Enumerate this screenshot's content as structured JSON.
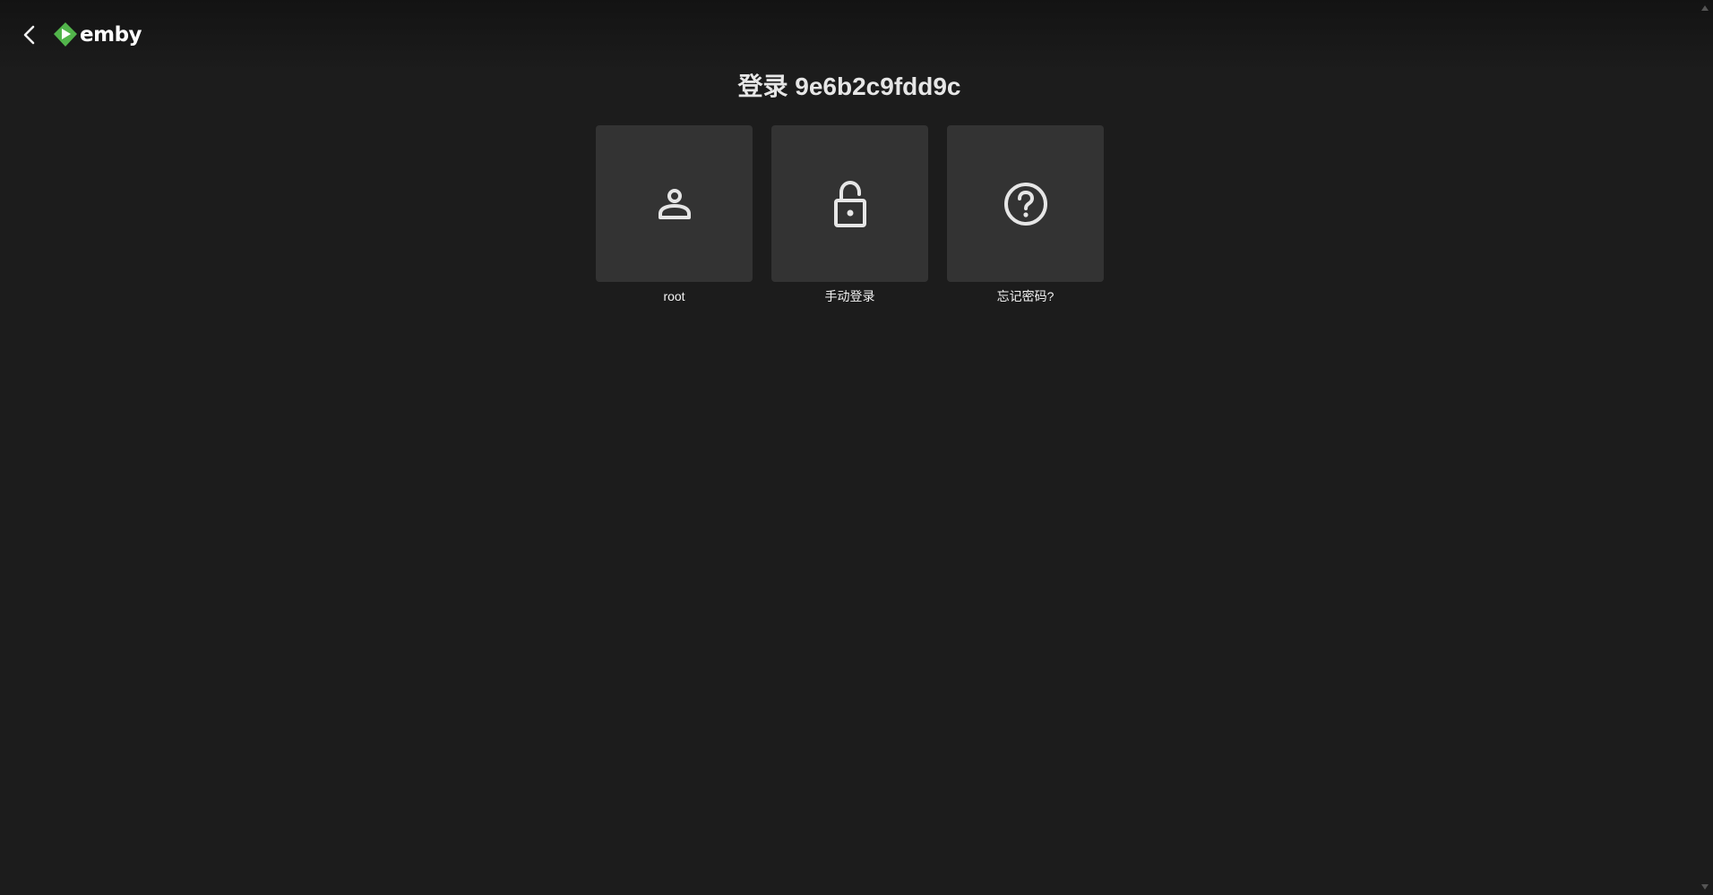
{
  "header": {
    "back_icon": "chevron-left-icon",
    "logo": {
      "icon": "emby-play-diamond-icon",
      "text": "emby",
      "brand_color": "#52b54b"
    }
  },
  "title": "登录 9e6b2c9fdd9c",
  "cards": [
    {
      "label": "root",
      "icon": "user-icon"
    },
    {
      "label": "手动登录",
      "icon": "lock-open-icon"
    },
    {
      "label": "忘记密码?",
      "icon": "help-circle-icon"
    }
  ],
  "colors": {
    "background": "#1c1c1c",
    "card_background": "#333333",
    "icon_color": "#e6e6e6",
    "text_color": "#f2f2f2"
  }
}
